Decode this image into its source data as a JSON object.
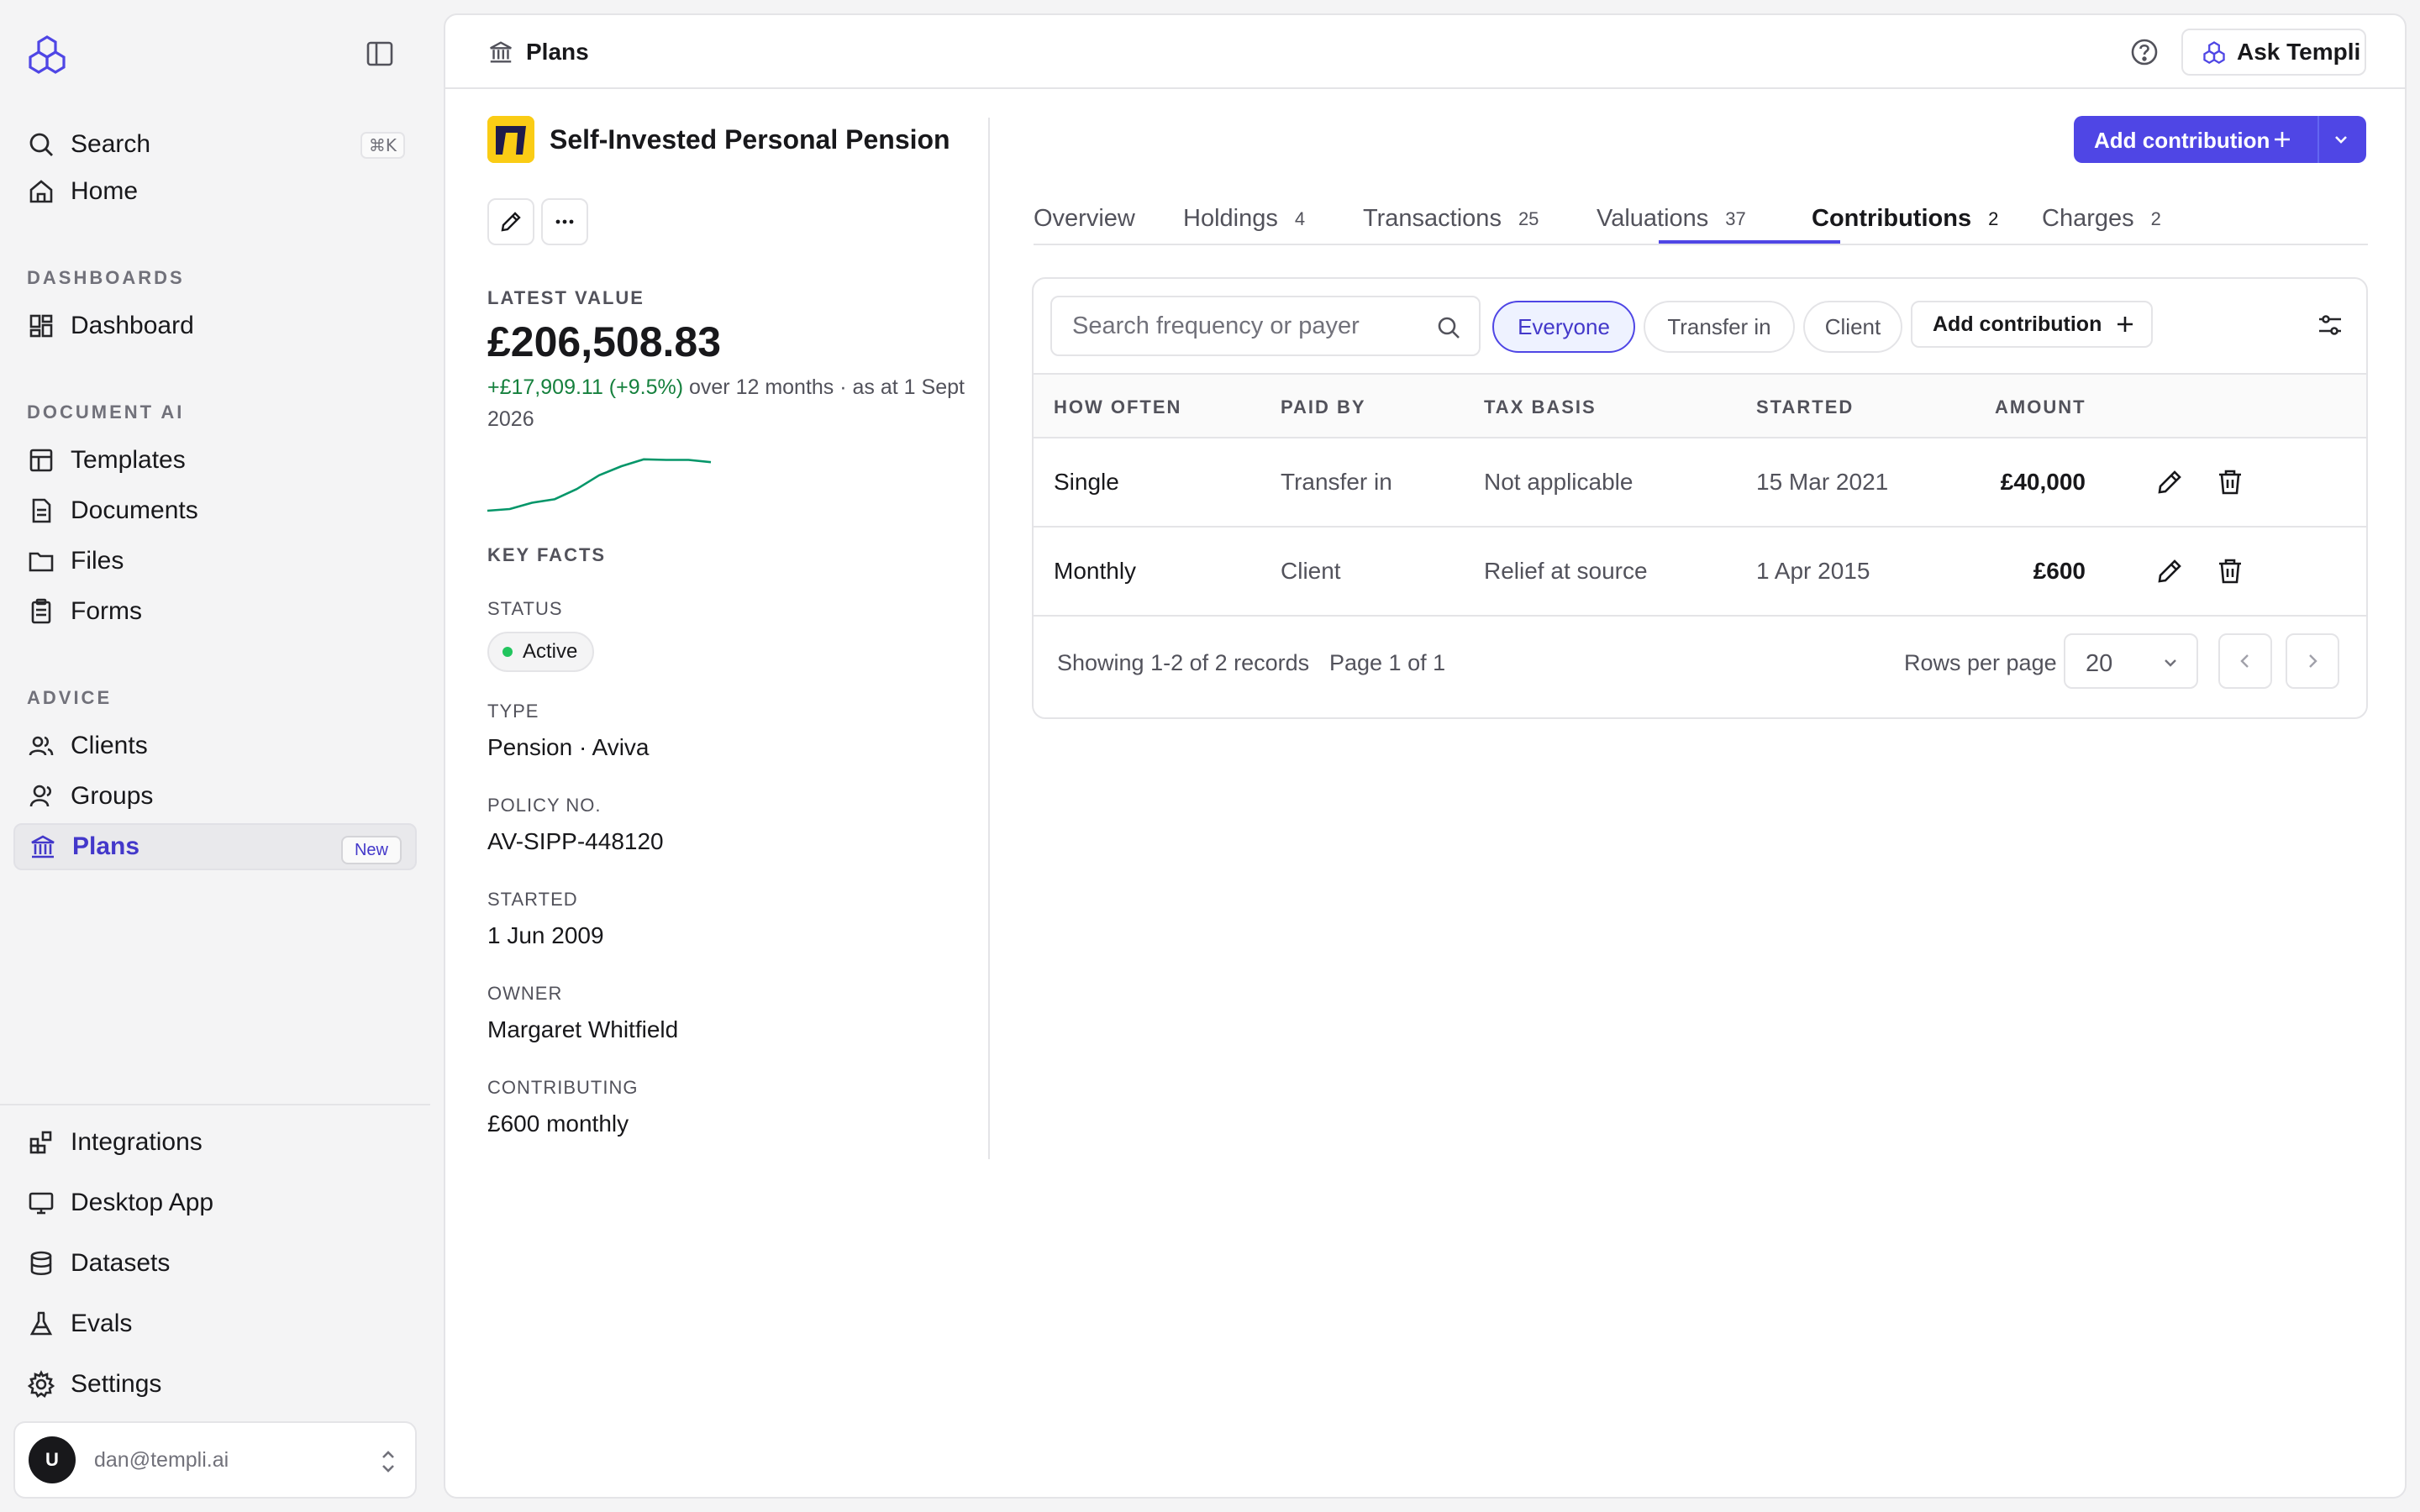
{
  "sidebar": {
    "search": {
      "label": "Search",
      "shortcut": "⌘K"
    },
    "home": "Home",
    "sections": {
      "dashboards": "DASHBOARDS",
      "document_ai": "DOCUMENT AI",
      "advice": "ADVICE"
    },
    "dashboard": "Dashboard",
    "templates": "Templates",
    "documents": "Documents",
    "files": "Files",
    "forms": "Forms",
    "clients": "Clients",
    "groups": "Groups",
    "plans": {
      "label": "Plans",
      "badge": "New"
    },
    "integrations": "Integrations",
    "desktop_app": "Desktop App",
    "datasets": "Datasets",
    "evals": "Evals",
    "settings": "Settings",
    "user": {
      "initial": "U",
      "email": "dan@templi.ai"
    }
  },
  "header": {
    "breadcrumb": "Plans",
    "ask_button": "Ask Templi"
  },
  "plan": {
    "title": "Self-Invested Personal Pension",
    "latest_value_label": "LATEST VALUE",
    "latest_value": "£206,508.83",
    "change": "+£17,909.11 (+9.5%)",
    "change_suffix": " over 12 months · as at 1 Sept 2026",
    "sparkline": [
      0,
      3,
      14,
      20,
      38,
      62,
      78,
      90,
      89,
      89,
      85
    ],
    "key_facts_label": "KEY FACTS",
    "facts": {
      "status_label": "STATUS",
      "status": "Active",
      "type_label": "TYPE",
      "type": "Pension · Aviva",
      "policy_label": "POLICY NO.",
      "policy": "AV-SIPP-448120",
      "started_label": "STARTED",
      "started": "1 Jun 2009",
      "owner_label": "OWNER",
      "owner": "Margaret Whitfield",
      "contributing_label": "CONTRIBUTING",
      "contributing": "£600 monthly"
    }
  },
  "actions": {
    "add_contribution": "Add contribution"
  },
  "tabs": [
    {
      "label": "Overview",
      "count": ""
    },
    {
      "label": "Holdings",
      "count": "4"
    },
    {
      "label": "Transactions",
      "count": "25"
    },
    {
      "label": "Valuations",
      "count": "37"
    },
    {
      "label": "Contributions",
      "count": "2"
    },
    {
      "label": "Charges",
      "count": "2"
    }
  ],
  "table": {
    "search_placeholder": "Search frequency or payer",
    "filters": [
      "Everyone",
      "Transfer in",
      "Client"
    ],
    "add_button": "Add contribution",
    "columns": [
      "HOW OFTEN",
      "PAID BY",
      "TAX BASIS",
      "STARTED",
      "AMOUNT"
    ],
    "rows": [
      {
        "how_often": "Single",
        "paid_by": "Transfer in",
        "tax_basis": "Not applicable",
        "started": "15 Mar 2021",
        "amount": "£40,000"
      },
      {
        "how_often": "Monthly",
        "paid_by": "Client",
        "tax_basis": "Relief at source",
        "started": "1 Apr 2015",
        "amount": "£600"
      }
    ],
    "footer": {
      "showing": "Showing 1-2 of 2 records",
      "page": "Page 1 of 1",
      "rows_per_page_label": "Rows per page",
      "rows_per_page": "20"
    }
  },
  "colors": {
    "accent": "#4f46e5",
    "positive": "#15803d",
    "status_active": "#22c55e",
    "plan_logo_bg": "#facc15"
  }
}
